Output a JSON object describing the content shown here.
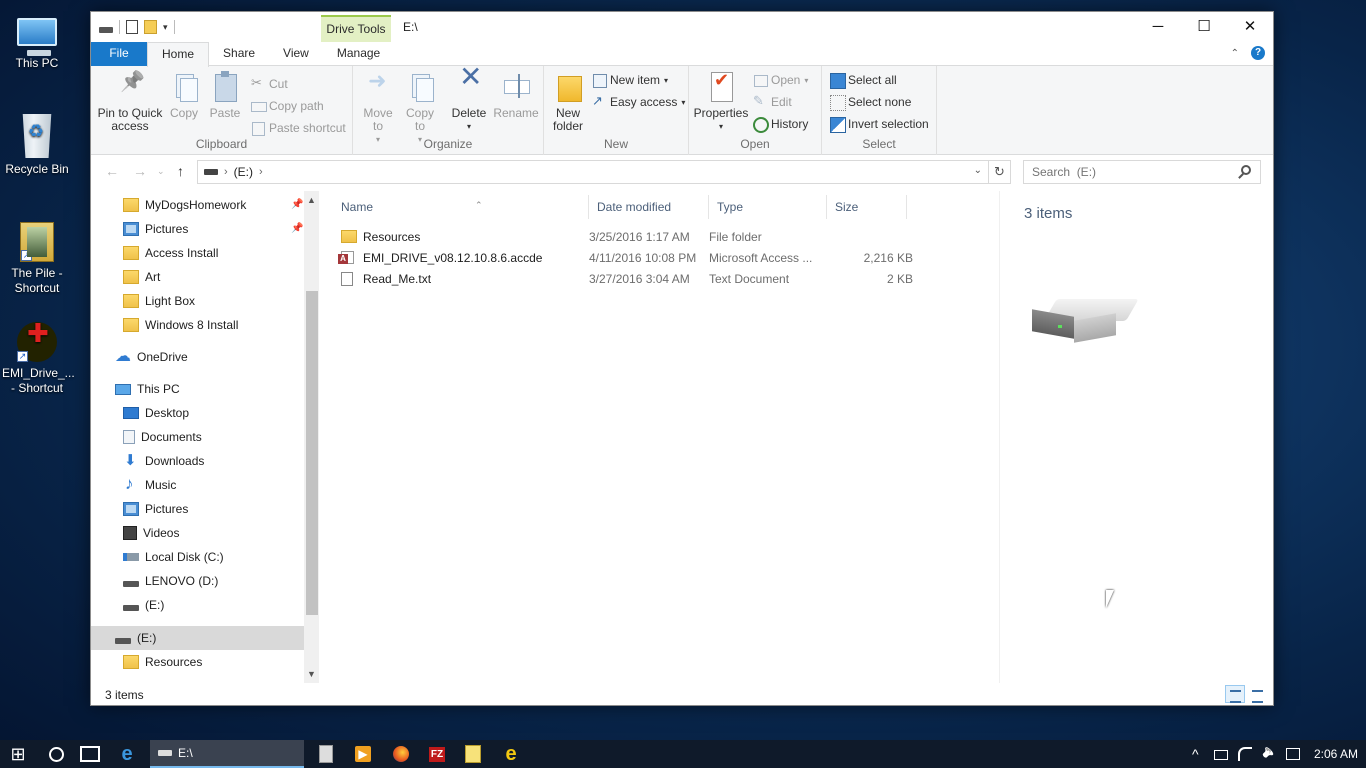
{
  "desktop": {
    "icons": [
      {
        "label": "This PC"
      },
      {
        "label": "Recycle Bin"
      },
      {
        "label": "The Pile - Shortcut"
      },
      {
        "label": "EMI_Drive_... - Shortcut"
      }
    ]
  },
  "window": {
    "contextual_tab": "Drive Tools",
    "title": "E:\\",
    "controls": {
      "minimize": "─",
      "maximize": "☐",
      "close": "✕"
    }
  },
  "menu": {
    "tabs": [
      "File",
      "Home",
      "Share",
      "View",
      "Manage"
    ],
    "active": "Home"
  },
  "ribbon": {
    "clipboard": {
      "label": "Clipboard",
      "pin": "Pin to Quick access",
      "copy": "Copy",
      "paste": "Paste",
      "cut": "Cut",
      "copy_path": "Copy path",
      "paste_shortcut": "Paste shortcut"
    },
    "organize": {
      "label": "Organize",
      "move_to": "Move to",
      "copy_to": "Copy to",
      "delete": "Delete",
      "rename": "Rename"
    },
    "new": {
      "label": "New",
      "new_folder": "New folder",
      "new_item": "New item",
      "easy_access": "Easy access"
    },
    "open": {
      "label": "Open",
      "properties": "Properties",
      "open": "Open",
      "edit": "Edit",
      "history": "History"
    },
    "select": {
      "label": "Select",
      "select_all": "Select all",
      "select_none": "Select none",
      "invert": "Invert selection"
    }
  },
  "address": {
    "path": "(E:)",
    "search_placeholder": "Search  (E:)"
  },
  "nav": {
    "items": [
      {
        "label": "MyDogsHomework",
        "icon": "folder-icon",
        "pinned": true
      },
      {
        "label": "Pictures",
        "icon": "pictures-icon",
        "pinned": true
      },
      {
        "label": "Access Install",
        "icon": "folder-icon"
      },
      {
        "label": "Art",
        "icon": "folder-icon"
      },
      {
        "label": "Light Box",
        "icon": "folder-icon"
      },
      {
        "label": "Windows 8 Install",
        "icon": "folder-icon"
      },
      {
        "label": "OneDrive",
        "icon": "cloud-icon"
      },
      {
        "label": "This PC",
        "icon": "computer-icon"
      },
      {
        "label": "Desktop",
        "icon": "desktop-icon"
      },
      {
        "label": "Documents",
        "icon": "documents-icon"
      },
      {
        "label": "Downloads",
        "icon": "download-icon"
      },
      {
        "label": "Music",
        "icon": "music-icon"
      },
      {
        "label": "Pictures",
        "icon": "pictures-icon"
      },
      {
        "label": "Videos",
        "icon": "videos-icon"
      },
      {
        "label": "Local Disk (C:)",
        "icon": "local-disk-icon"
      },
      {
        "label": "LENOVO (D:)",
        "icon": "drive-icon"
      },
      {
        "label": "(E:)",
        "icon": "drive-icon"
      },
      {
        "label": "(E:)",
        "icon": "drive-icon",
        "selected": true
      },
      {
        "label": "Resources",
        "icon": "folder-icon"
      }
    ]
  },
  "files": {
    "columns": [
      "Name",
      "Date modified",
      "Type",
      "Size"
    ],
    "rows": [
      {
        "name": "Resources",
        "date": "3/25/2016 1:17 AM",
        "type": "File folder",
        "size": "",
        "icon": "folder-icon"
      },
      {
        "name": "EMI_DRIVE_v08.12.10.8.6.accde",
        "date": "4/11/2016 10:08 PM",
        "type": "Microsoft Access ...",
        "size": "2,216 KB",
        "icon": "access-file-icon"
      },
      {
        "name": "Read_Me.txt",
        "date": "3/27/2016 3:04 AM",
        "type": "Text Document",
        "size": "2 KB",
        "icon": "text-file-icon"
      }
    ]
  },
  "preview": {
    "count": "3 items"
  },
  "status": {
    "count": "3 items"
  },
  "taskbar": {
    "active_app": "E:\\",
    "clock": "2:06 AM"
  }
}
